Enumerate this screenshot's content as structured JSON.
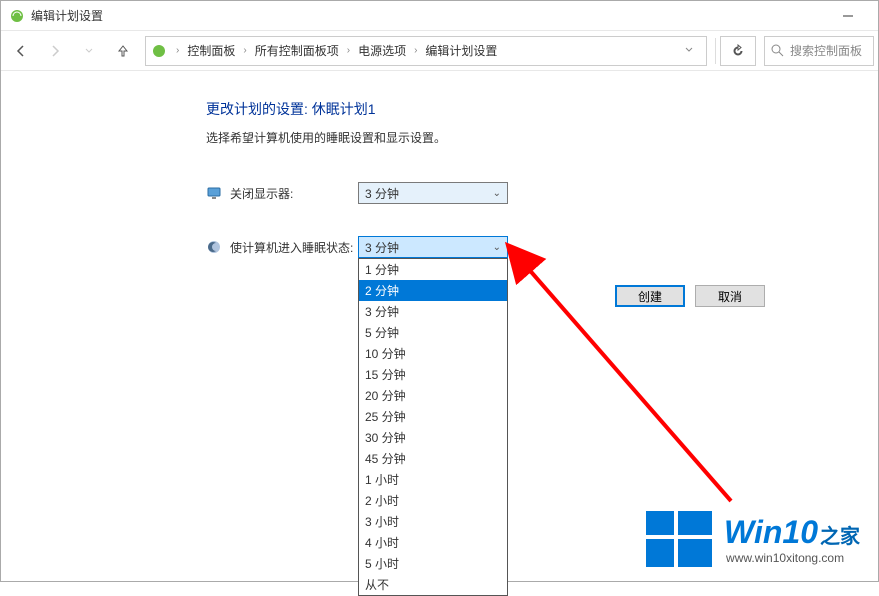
{
  "window": {
    "title": "编辑计划设置",
    "minimize": "－"
  },
  "breadcrumb": {
    "items": [
      "控制面板",
      "所有控制面板项",
      "电源选项",
      "编辑计划设置"
    ]
  },
  "search": {
    "placeholder": "搜索控制面板"
  },
  "page": {
    "heading": "更改计划的设置: 休眠计划1",
    "subtext": "选择希望计算机使用的睡眠设置和显示设置。"
  },
  "rows": {
    "display": {
      "label": "关闭显示器:",
      "value": "3 分钟"
    },
    "sleep": {
      "label": "使计算机进入睡眠状态:",
      "value": "3 分钟"
    }
  },
  "dropdown": {
    "options": [
      "1 分钟",
      "2 分钟",
      "3 分钟",
      "5 分钟",
      "10 分钟",
      "15 分钟",
      "20 分钟",
      "25 分钟",
      "30 分钟",
      "45 分钟",
      "1 小时",
      "2 小时",
      "3 小时",
      "4 小时",
      "5 小时",
      "从不"
    ],
    "highlighted_index": 1
  },
  "buttons": {
    "create": "创建",
    "cancel": "取消"
  },
  "watermark": {
    "title_main": "Win10",
    "title_sub": "之家",
    "url": "www.win10xitong.com"
  }
}
